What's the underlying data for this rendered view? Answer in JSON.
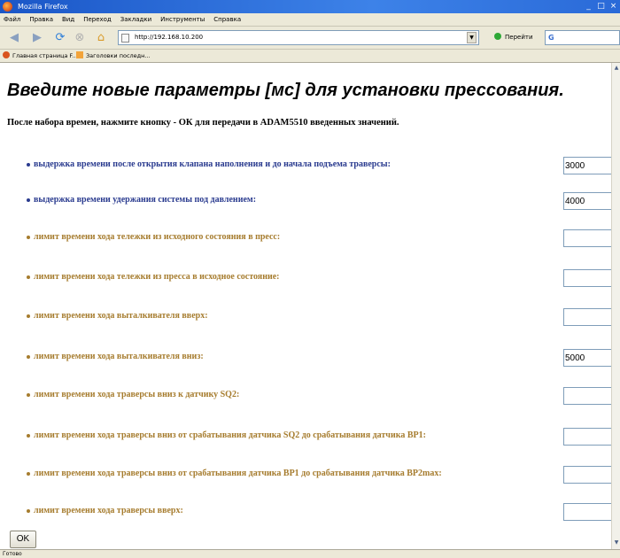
{
  "window": {
    "title": "Mozilla Firefox",
    "controls": [
      "_",
      "□",
      "×"
    ]
  },
  "menu": [
    "Файл",
    "Правка",
    "Вид",
    "Переход",
    "Закладки",
    "Инструменты",
    "Справка"
  ],
  "nav": {
    "url": "http://192.168.10.200",
    "go_label": "Перейти",
    "search_value": "G"
  },
  "bookmarks": [
    "Главная страница F...",
    "Заголовки последн..."
  ],
  "page": {
    "title": "Введите новые параметры [мс] для установки прессования.",
    "instruction": "После набора времен, нажмите кнопку - ОК для передачи в ADAM5510 введенных значений.",
    "params": [
      {
        "label": "выдержка времени после открытия клапана наполнения и до начала подъема траверсы:",
        "value": "3000",
        "color": "#2a3b8f"
      },
      {
        "label": "выдержка времени удержания системы под давлением:",
        "value": "4000",
        "color": "#2a3b8f"
      },
      {
        "label": "лимит времени хода тележки из исходного состояния в пресс:",
        "value": "",
        "color": "#a67c2e"
      },
      {
        "label": "лимит времени хода тележки из пресса в исходное состояние:",
        "value": "",
        "color": "#a67c2e"
      },
      {
        "label": "лимит времени хода выталкивателя вверх:",
        "value": "",
        "color": "#a67c2e"
      },
      {
        "label": "лимит времени хода выталкивателя вниз:",
        "value": "5000",
        "color": "#a67c2e"
      },
      {
        "label": "лимит времени хода траверсы вниз к датчику SQ2:",
        "value": "",
        "color": "#a67c2e"
      },
      {
        "label": "лимит времени хода траверсы вниз от срабатывания датчика SQ2 до срабатывания датчика ВР1:",
        "value": "",
        "color": "#a67c2e"
      },
      {
        "label": "лимит времени хода траверсы вниз от срабатывания датчика ВР1 до срабатывания датчика ВР2max:",
        "value": "",
        "color": "#a67c2e"
      },
      {
        "label": "лимит времени хода траверсы вверх:",
        "value": "",
        "color": "#a67c2e"
      }
    ],
    "ok_label": "OK"
  },
  "status": "Готово"
}
